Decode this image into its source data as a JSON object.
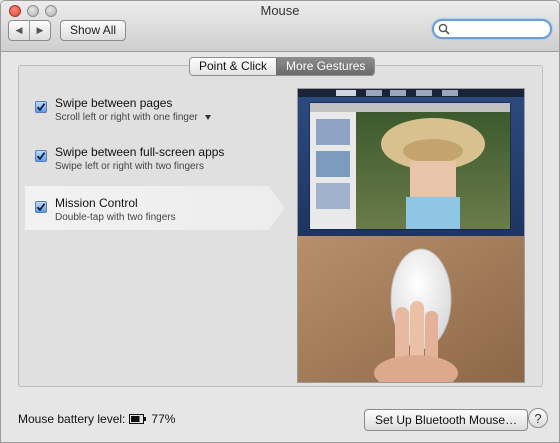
{
  "window": {
    "title": "Mouse"
  },
  "toolbar": {
    "show_all_label": "Show All",
    "search_placeholder": ""
  },
  "tabs": [
    {
      "label": "Point & Click",
      "selected": false
    },
    {
      "label": "More Gestures",
      "selected": true
    }
  ],
  "gestures": [
    {
      "title": "Swipe between pages",
      "description": "Scroll left or right with one finger",
      "checked": true,
      "has_menu": true,
      "selected": false
    },
    {
      "title": "Swipe between full-screen apps",
      "description": "Swipe left or right with two fingers",
      "checked": true,
      "has_menu": false,
      "selected": false
    },
    {
      "title": "Mission Control",
      "description": "Double-tap with two fingers",
      "checked": true,
      "has_menu": false,
      "selected": true
    }
  ],
  "footer": {
    "battery_label": "Mouse battery level:",
    "battery_value": "77%",
    "battery_fraction": 0.77,
    "setup_button_label": "Set Up Bluetooth Mouse…",
    "help_label": "?"
  },
  "colors": {
    "accent": "#5f9ce8",
    "search_focus": "#6a9ed6"
  }
}
